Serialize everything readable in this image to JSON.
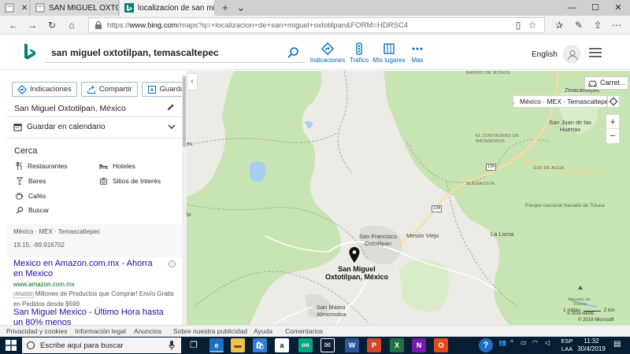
{
  "browser": {
    "tabs": [
      {
        "label": "",
        "favicon": "edge-page-icon"
      },
      {
        "label": "SAN MIGUEL OXTOTILPAN (",
        "favicon": "edge-page-icon"
      },
      {
        "label": "localizacion de san mig",
        "favicon": "bing-favicon",
        "active": true
      }
    ],
    "url_scheme": "https://",
    "url_domain": "www.bing.com",
    "url_path": "/maps?q=+localizacion+de+san+miguel+oxtotilpan&FORM=HDRSC4"
  },
  "header": {
    "search_value": "san miguel oxtotilpan, temascaltepec",
    "actions": [
      {
        "label": "Indicaciones",
        "icon": "directions-icon"
      },
      {
        "label": "Tráfico",
        "icon": "traffic-icon"
      },
      {
        "label": "Mis lugares",
        "icon": "my-places-icon"
      },
      {
        "label": "Más",
        "icon": "more-icon"
      }
    ],
    "language": "English"
  },
  "panel": {
    "buttons": [
      {
        "label": "Indicaciones",
        "icon": "directions-icon"
      },
      {
        "label": "Compartir",
        "icon": "share-icon"
      },
      {
        "label": "Guardar",
        "icon": "save-icon"
      }
    ],
    "place_title": "San Miguel Oxtotilpan, México",
    "calendar_label": "Guardar en calendario",
    "nearby_title": "Cerca",
    "nearby": [
      {
        "label": "Restaurantes",
        "icon": "fork-knife-icon"
      },
      {
        "label": "Hoteles",
        "icon": "bed-icon"
      },
      {
        "label": "Bares",
        "icon": "cocktail-icon"
      },
      {
        "label": "Sitios de Interés",
        "icon": "landmark-icon"
      },
      {
        "label": "Cafés",
        "icon": "coffee-icon"
      },
      {
        "label": "Buscar",
        "icon": "search-icon"
      }
    ],
    "region": "México · MEX · Temascaltepec",
    "coordinates": "19.15, -99.916702",
    "ads": [
      {
        "title": "Mexico en Amazon.com.mx - Ahorra en Mexico",
        "url": "www.amazon.com.mx",
        "badge": "Anuncio",
        "description": "Millones de Productos que Comprar! Envío Gratis en Pedidos desde $599"
      },
      {
        "title": "San Miguel Mexico - Último Hora hasta un 80% menos"
      }
    ]
  },
  "map": {
    "traffic_button": "Carret...",
    "location_bar": "México · MEX · Temascaltepec",
    "pin_label": "San Miguel Oxtotilpan, México",
    "labels": {
      "barrio_de_monos": "BARRIO DE MONOS",
      "zinacantepec": "Zinacantepec",
      "san_juan": "San Juan de las Huertas",
      "el_contadero": "EL CONTADERO DE MATAMOROS",
      "ojo_de_agua": "OJO DE AGUA",
      "buenavista": "BUENAVISTA",
      "parque": "Parque nacional Nevado de Toluca",
      "san_francisco": "San Francisco Oxtotilpan",
      "meson_viejo": "Mesón Viejo",
      "la_loma": "La Loma",
      "san_mateo": "San Mateo Almomoloa",
      "nevado_de_toluca": "Nevado de Toluca",
      "road_134_a": "134",
      "road_134_b": "134",
      "left_pec": "pec",
      "left_olo": "olo"
    },
    "scale_miles": "1 millas",
    "scale_km": "2 km",
    "copyright": "© 2019 Microsoft",
    "copyright_here": "© 2019 HERE"
  },
  "footer": {
    "links": [
      "Privacidad y cookies",
      "Información legal",
      "Anuncios",
      "Sobre nuestra publicidad",
      "Ayuda",
      "Comentarios"
    ]
  },
  "taskbar": {
    "search_placeholder": "Escribe aquí para buscar",
    "apps": [
      "task-view-icon",
      "edge-icon",
      "file-explorer-icon",
      "store-icon",
      "amazon-icon",
      "tripadvisor-icon",
      "mail-icon",
      "word-icon",
      "powerpoint-icon",
      "excel-icon",
      "onenote-icon",
      "office-icon"
    ],
    "help_icon": "help-icon",
    "lang_line1": "ESP",
    "lang_line2": "LAA",
    "time": "11:32",
    "date": "30/4/2019"
  }
}
